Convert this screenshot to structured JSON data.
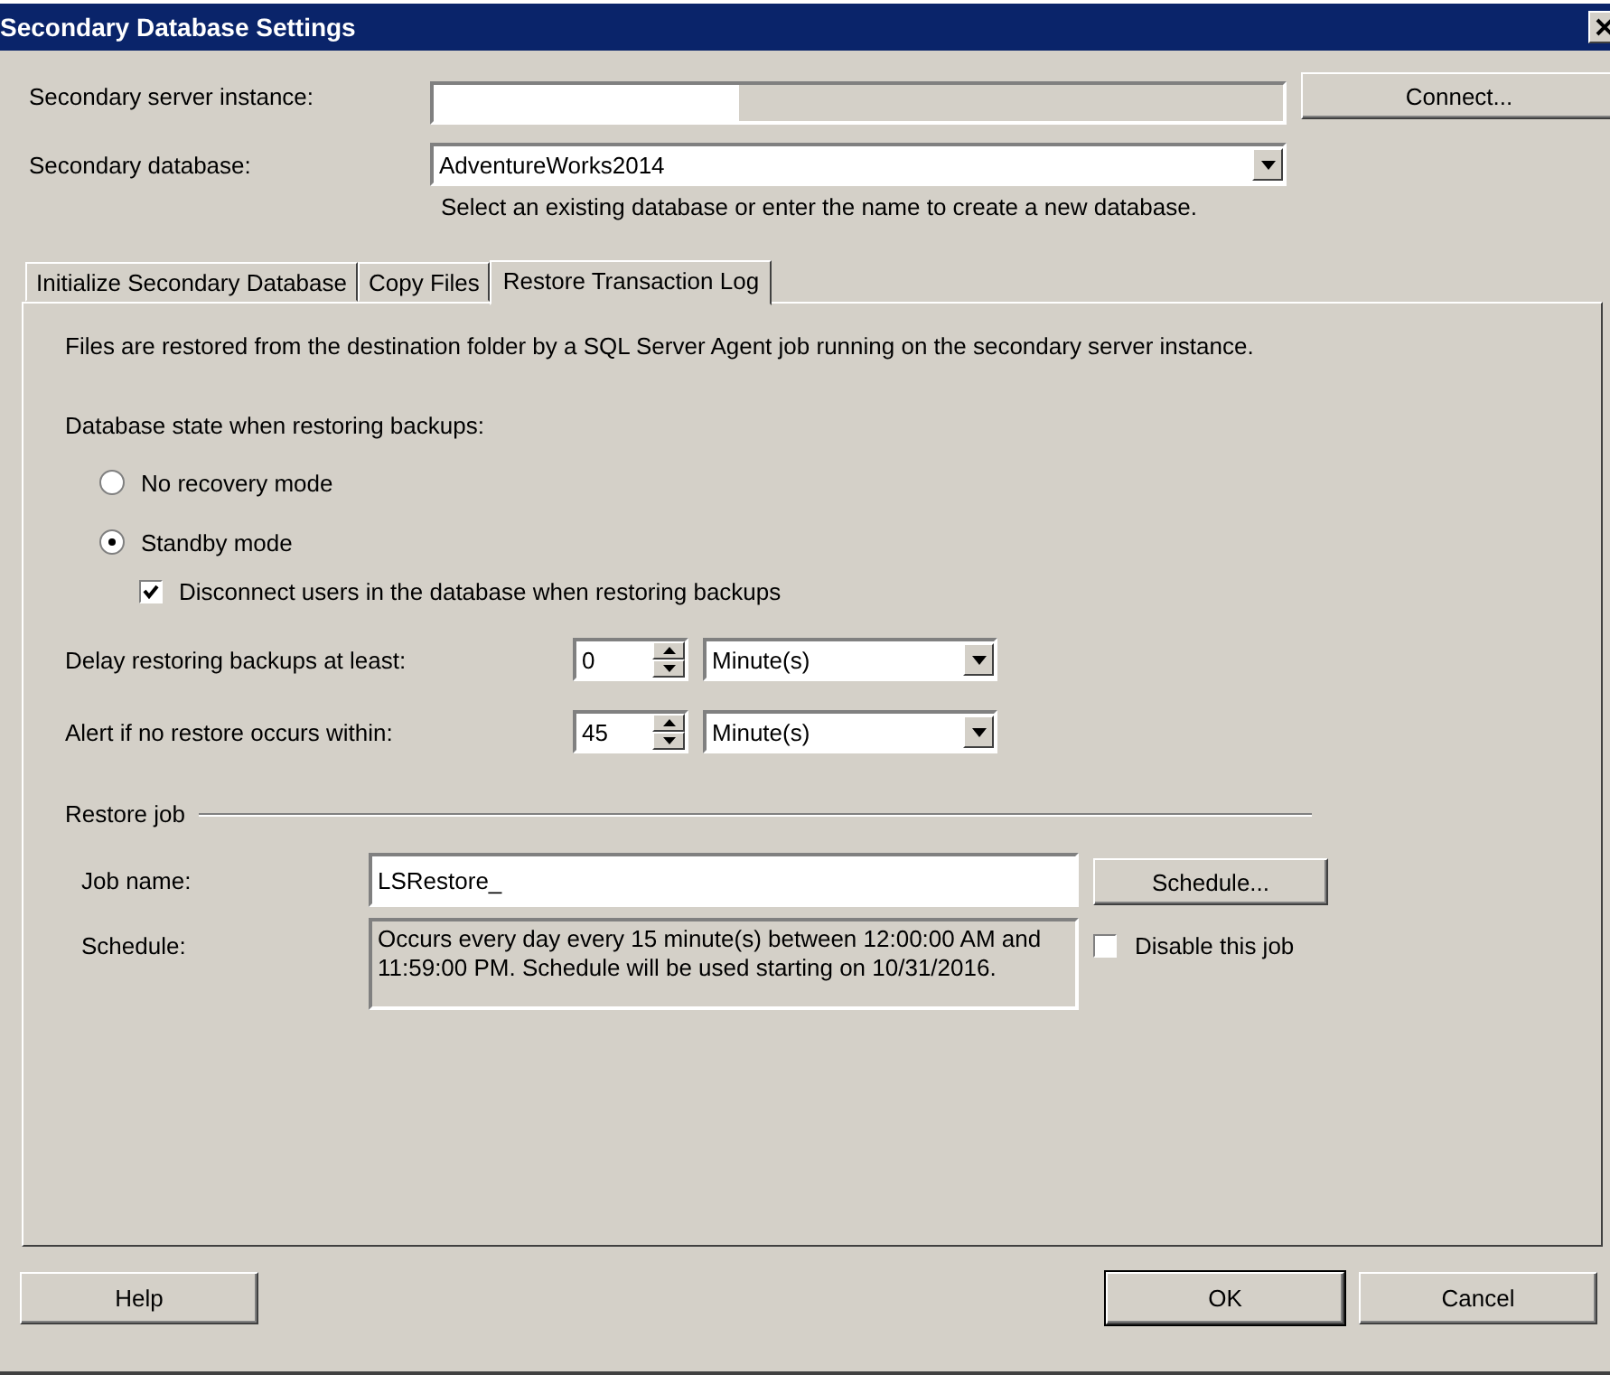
{
  "window": {
    "title": "Secondary Database Settings"
  },
  "server_instance": {
    "label": "Secondary server instance:",
    "disabled": true,
    "button": "Connect..."
  },
  "database": {
    "label": "Secondary database:",
    "value": "AdventureWorks2014",
    "hint": "Select an existing database or enter the name to create a new database."
  },
  "tabs": [
    {
      "label": "Initialize Secondary Database",
      "selected": false
    },
    {
      "label": "Copy Files",
      "selected": false
    },
    {
      "label": "Restore Transaction Log",
      "selected": true
    }
  ],
  "restore": {
    "description": "Files are restored from the destination folder by a SQL Server Agent job running on the secondary server instance.",
    "state_label": "Database state when restoring backups:",
    "modes": [
      {
        "label": "No recovery mode",
        "selected": false
      },
      {
        "label": "Standby mode",
        "selected": true
      }
    ],
    "disconnect": {
      "label": "Disconnect users in the database when restoring backups",
      "checked": true
    },
    "delays": [
      {
        "label": "Delay restoring backups at least:",
        "value": "0",
        "unit": "Minute(s)"
      },
      {
        "label": "Alert if no restore occurs within:",
        "value": "45",
        "unit": "Minute(s)"
      }
    ],
    "job": {
      "section": "Restore job",
      "name_label": "Job name:",
      "name_value": "LSRestore_",
      "schedule_label": "Schedule:",
      "schedule": "Occurs every day every 15 minute(s) between 12:00:00 AM and 11:59:00 PM. Schedule will be used starting on 10/31/2016.",
      "schedule_button": "Schedule...",
      "disable": {
        "label": "Disable this job",
        "checked": false
      }
    }
  },
  "buttons": [
    {
      "label": "Help",
      "default": false
    },
    {
      "label": "OK",
      "default": true
    },
    {
      "label": "Cancel",
      "default": false
    }
  ]
}
